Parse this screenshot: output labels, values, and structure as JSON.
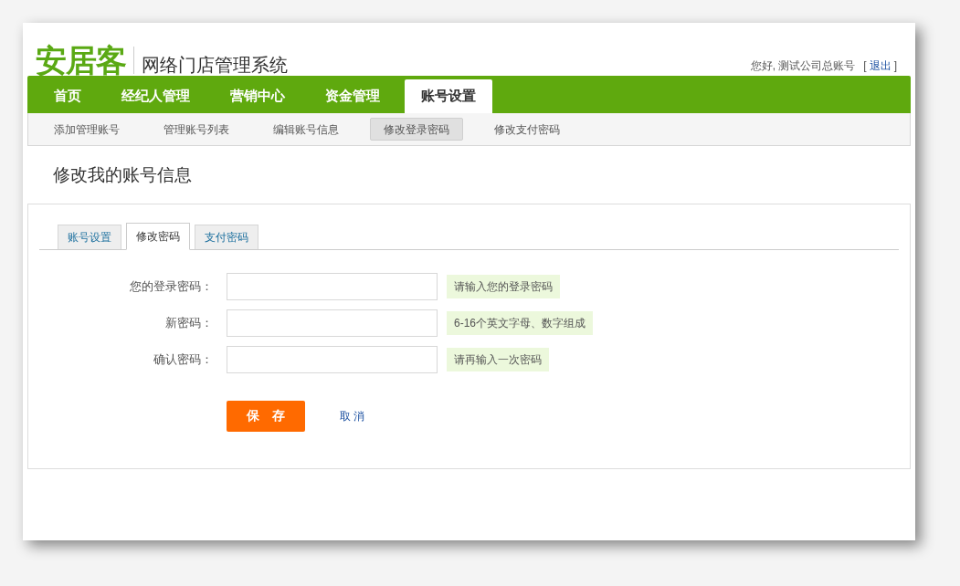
{
  "header": {
    "logo": "安居客",
    "system_name": "网络门店管理系统",
    "greeting": "您好, 测试公司总账号",
    "logout_open": "[",
    "logout": "退出",
    "logout_close": "]"
  },
  "nav": [
    {
      "label": "首页",
      "selected": false
    },
    {
      "label": "经纪人管理",
      "selected": false
    },
    {
      "label": "营销中心",
      "selected": false
    },
    {
      "label": "资金管理",
      "selected": false
    },
    {
      "label": "账号设置",
      "selected": true
    }
  ],
  "subnav": [
    {
      "label": "添加管理账号",
      "selected": false
    },
    {
      "label": "管理账号列表",
      "selected": false
    },
    {
      "label": "编辑账号信息",
      "selected": false
    },
    {
      "label": "修改登录密码",
      "selected": true
    },
    {
      "label": "修改支付密码",
      "selected": false
    }
  ],
  "page_title": "修改我的账号信息",
  "tabs": [
    {
      "label": "账号设置",
      "selected": false
    },
    {
      "label": "修改密码",
      "selected": true
    },
    {
      "label": "支付密码",
      "selected": false
    }
  ],
  "form": {
    "fields": [
      {
        "label": "您的登录密码：",
        "hint": "请输入您的登录密码"
      },
      {
        "label": "新密码：",
        "hint": "6-16个英文字母、数字组成"
      },
      {
        "label": "确认密码：",
        "hint": "请再输入一次密码"
      }
    ],
    "save": "保　存",
    "cancel": "取 消"
  }
}
